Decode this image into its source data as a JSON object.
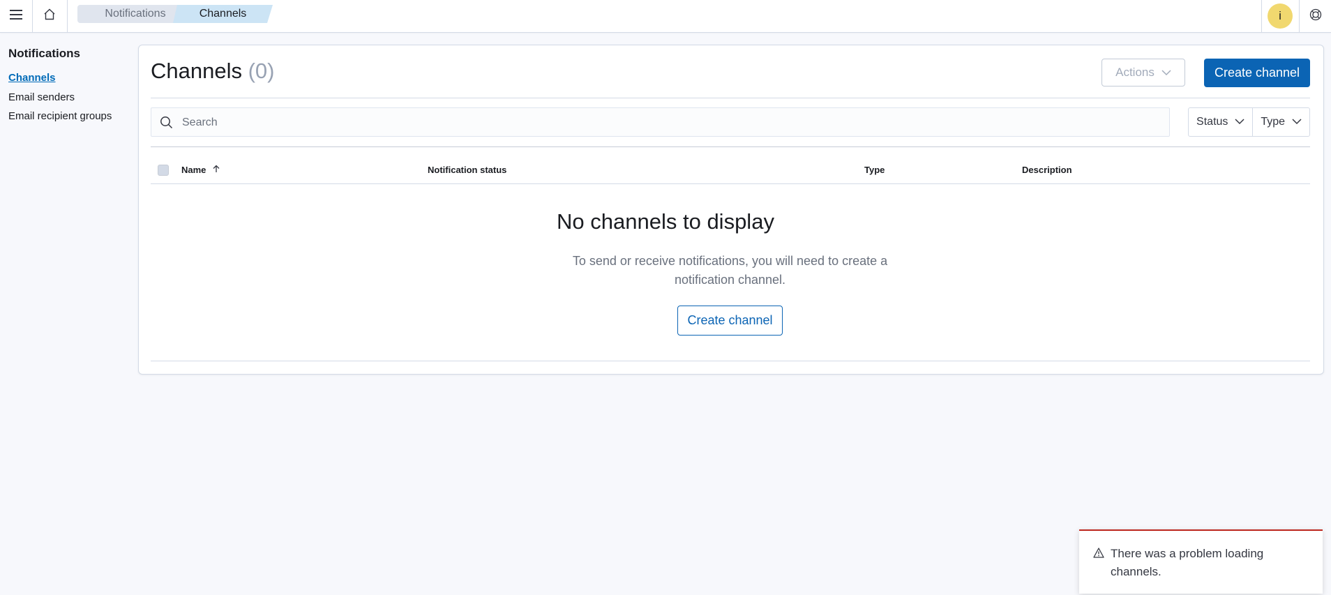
{
  "header": {
    "menu_icon": "hamburger-menu-icon",
    "home_icon": "home-icon",
    "breadcrumbs": [
      "Notifications",
      "Channels"
    ],
    "avatar_initial": "i",
    "help_icon": "help-icon"
  },
  "sidebar": {
    "title": "Notifications",
    "items": [
      {
        "label": "Channels",
        "active": true
      },
      {
        "label": "Email senders",
        "active": false
      },
      {
        "label": "Email recipient groups",
        "active": false
      }
    ]
  },
  "main": {
    "title": "Channels",
    "count": "(0)",
    "actions_label": "Actions",
    "create_label": "Create channel",
    "search_placeholder": "Search",
    "filters": [
      "Status",
      "Type"
    ],
    "columns": [
      "Name",
      "Notification status",
      "Type",
      "Description"
    ],
    "sort_icon": "arrow-up-icon",
    "empty": {
      "title": "No channels to display",
      "body": "To send or receive notifications, you will need to create a notification channel.",
      "button": "Create channel"
    }
  },
  "toast": {
    "icon": "warning-icon",
    "message": "There was a problem loading channels."
  },
  "colors": {
    "primary": "#0b64b4",
    "danger": "#bd271e",
    "avatar": "#f1d86f"
  }
}
